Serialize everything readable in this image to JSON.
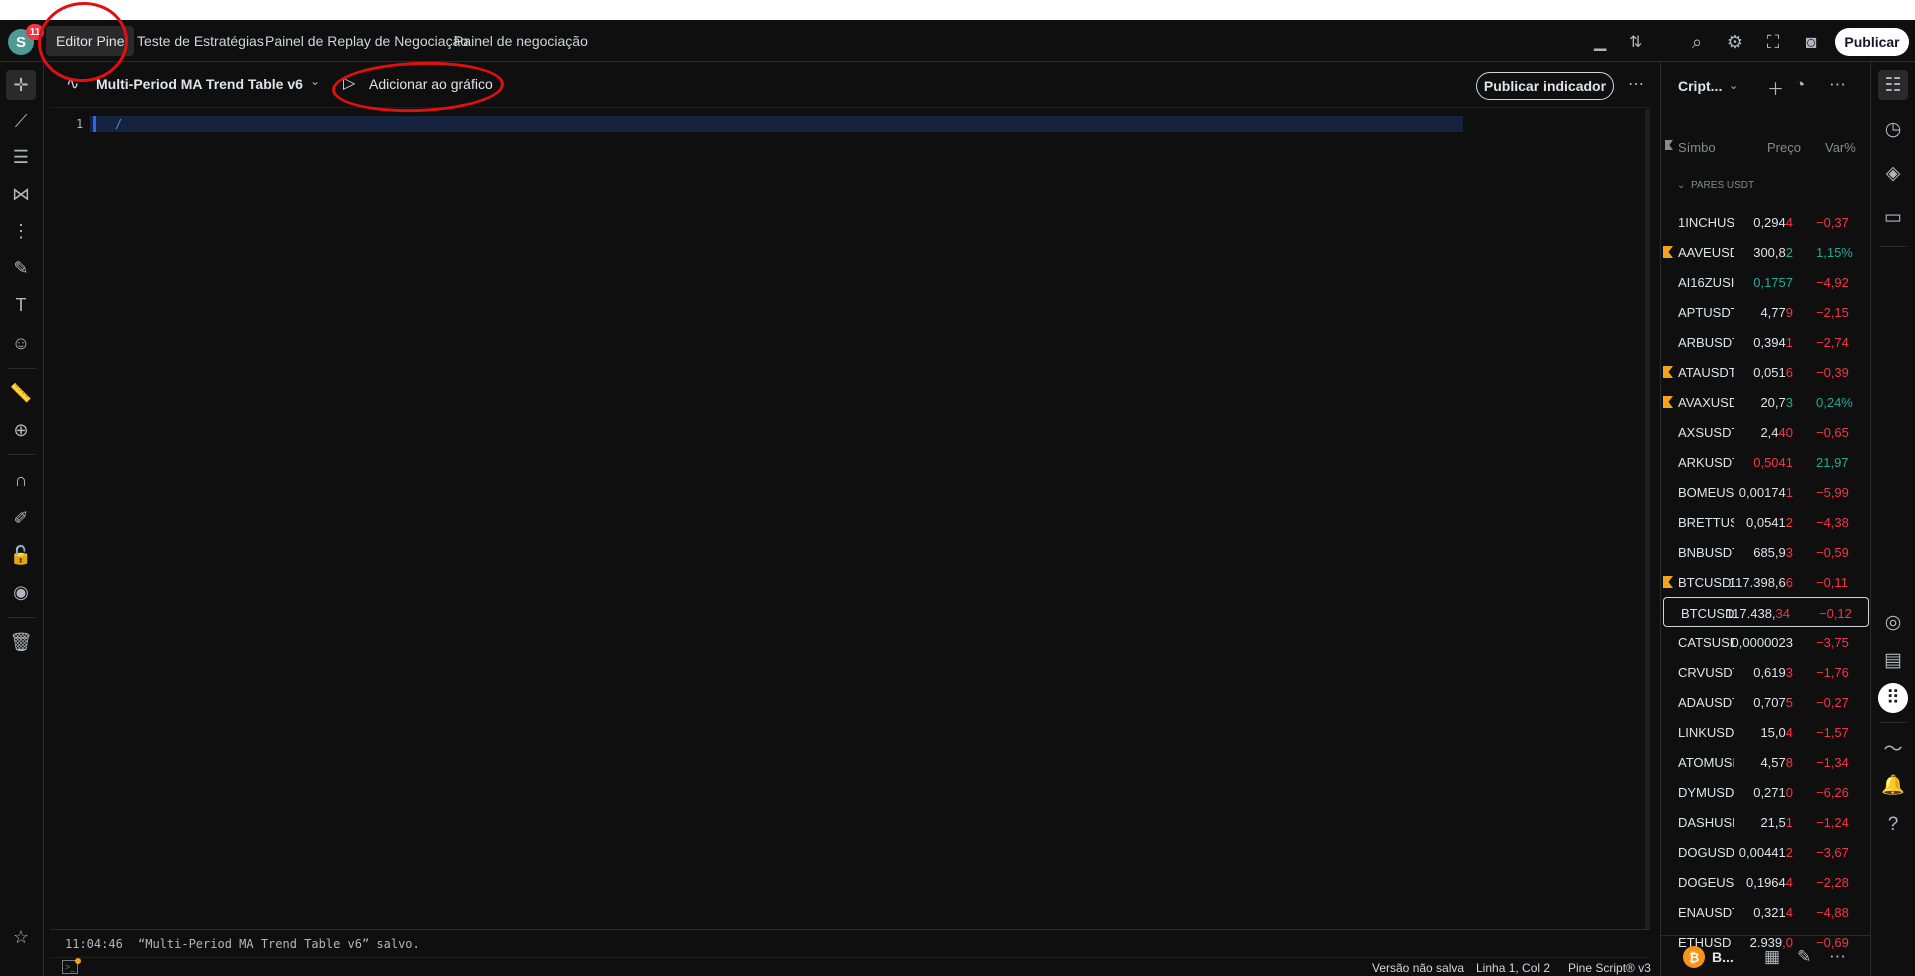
{
  "topbar": {
    "avatar_letter": "S",
    "notification_count": "11",
    "tabs": [
      {
        "label": "Editor Pine",
        "active": true
      },
      {
        "label": "Teste de Estratégias",
        "active": false
      },
      {
        "label": "Painel de Replay de Negociação",
        "active": false
      },
      {
        "label": "Painel de negociação",
        "active": false
      }
    ],
    "publish_label": "Publicar"
  },
  "editor": {
    "script_title": "Multi-Period MA Trend Table v6",
    "add_to_chart_label": "Adicionar ao gráfico",
    "publish_indicator_label": "Publicar indicador",
    "line_number": "1",
    "code_line": "/"
  },
  "console": {
    "time": "11:04:46",
    "message": "“Multi-Period MA Trend Table v6” salvo."
  },
  "statusbar": {
    "save_state": "Versão não salva",
    "cursor_position": "Linha 1, Col 2",
    "language": "Pine Script® v3"
  },
  "watchlist": {
    "name": "Cript...",
    "columns": {
      "symbol": "Símbo",
      "price": "Preço",
      "change": "Var%"
    },
    "group_label": "PARES USDT",
    "rows": [
      {
        "symbol": "1INCHUS",
        "price": "0,294",
        "price_tail": "4",
        "change": "−0,37",
        "flagged": false,
        "dir": "neg"
      },
      {
        "symbol": "AAVEUSD",
        "price": "300,8",
        "price_tail": "2",
        "change": "1,15%",
        "flagged": true,
        "dir": "pos"
      },
      {
        "symbol": "AI16ZUSI",
        "price": "0,1757",
        "price_tail": "",
        "change": "−4,92",
        "flagged": false,
        "dir": "neg",
        "price_color": "pos"
      },
      {
        "symbol": "APTUSDT",
        "price": "4,77",
        "price_tail": "9",
        "change": "−2,15",
        "flagged": false,
        "dir": "neg"
      },
      {
        "symbol": "ARBUSDT",
        "price": "0,394",
        "price_tail": "1",
        "change": "−2,74",
        "flagged": false,
        "dir": "neg"
      },
      {
        "symbol": "ATAUSDT",
        "price": "0,051",
        "price_tail": "6",
        "change": "−0,39",
        "flagged": true,
        "dir": "neg"
      },
      {
        "symbol": "AVAXUSD",
        "price": "20,7",
        "price_tail": "3",
        "change": "0,24%",
        "flagged": true,
        "dir": "pos"
      },
      {
        "symbol": "AXSUSDT",
        "price": "2,4",
        "price_tail": "40",
        "change": "−0,65",
        "flagged": false,
        "dir": "neg"
      },
      {
        "symbol": "ARKUSDT",
        "price": "0,5041",
        "price_tail": "",
        "change": "21,97",
        "flagged": false,
        "dir": "pos",
        "price_color": "neg"
      },
      {
        "symbol": "BOMEUSI",
        "price": "0,00174",
        "price_tail": "1",
        "change": "−5,99",
        "flagged": false,
        "dir": "neg"
      },
      {
        "symbol": "BRETTUS",
        "price": "0,0541",
        "price_tail": "2",
        "change": "−4,38",
        "flagged": false,
        "dir": "neg"
      },
      {
        "symbol": "BNBUSDT",
        "price": "685,9",
        "price_tail": "3",
        "change": "−0,59",
        "flagged": false,
        "dir": "neg"
      },
      {
        "symbol": "BTCUSDT",
        "price": "117.398,6",
        "price_tail": "6",
        "change": "−0,11",
        "flagged": true,
        "dir": "neg"
      },
      {
        "symbol": "BTCUSD",
        "price": "117.438,",
        "price_tail": "34",
        "change": "−0,12",
        "flagged": false,
        "dir": "neg",
        "selected": true
      },
      {
        "symbol": "CATSUSD",
        "price": "0,0000023",
        "price_tail": "",
        "change": "−3,75",
        "flagged": false,
        "dir": "neg"
      },
      {
        "symbol": "CRVUSDT",
        "price": "0,619",
        "price_tail": "3",
        "change": "−1,76",
        "flagged": false,
        "dir": "neg"
      },
      {
        "symbol": "ADAUSDT",
        "price": "0,707",
        "price_tail": "5",
        "change": "−0,27",
        "flagged": false,
        "dir": "neg"
      },
      {
        "symbol": "LINKUSD",
        "price": "15,0",
        "price_tail": "4",
        "change": "−1,57",
        "flagged": false,
        "dir": "neg"
      },
      {
        "symbol": "ATOMUSI",
        "price": "4,57",
        "price_tail": "8",
        "change": "−1,34",
        "flagged": false,
        "dir": "neg"
      },
      {
        "symbol": "DYMUSDT",
        "price": "0,271",
        "price_tail": "0",
        "change": "−6,26",
        "flagged": false,
        "dir": "neg"
      },
      {
        "symbol": "DASHUSE",
        "price": "21,5",
        "price_tail": "1",
        "change": "−1,24",
        "flagged": false,
        "dir": "neg"
      },
      {
        "symbol": "DOGUSDT",
        "price": "0,00441",
        "price_tail": "2",
        "change": "−3,67",
        "flagged": false,
        "dir": "neg"
      },
      {
        "symbol": "DOGEUSI",
        "price": "0,1964",
        "price_tail": "4",
        "change": "−2,28",
        "flagged": false,
        "dir": "neg"
      },
      {
        "symbol": "ENAUSDT",
        "price": "0,321",
        "price_tail": "4",
        "change": "−4,88",
        "flagged": false,
        "dir": "neg"
      },
      {
        "symbol": "ETHUSD",
        "price": "2.939",
        "price_tail": ",0",
        "change": "−0,69",
        "flagged": false,
        "dir": "neg"
      }
    ],
    "footer_label": "B..."
  },
  "icons": {
    "left_toolbar": [
      "crosshair-icon",
      "trend-line-icon",
      "fib-icon",
      "pattern-icon",
      "forecast-icon",
      "brush-icon",
      "text-icon",
      "emoji-icon",
      "ruler-icon",
      "zoom-icon",
      "magnet-icon",
      "lock-drawing-icon",
      "lock-icon",
      "eye-icon",
      "trash-icon",
      "star-icon"
    ],
    "right_rail": [
      "watchlist-icon",
      "alert-clock-icon",
      "layers-icon",
      "chat-icon",
      "target-icon",
      "calendar-icon",
      "apps-icon",
      "signal-icon",
      "bell-icon",
      "help-icon"
    ]
  },
  "colors": {
    "background": "#0f0f0f",
    "negative": "#f23645",
    "positive": "#22ab94",
    "flag": "#f7a21b",
    "annotation": "#e01010"
  }
}
